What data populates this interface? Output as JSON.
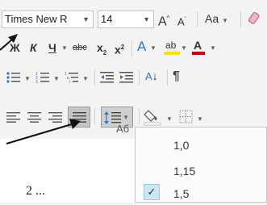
{
  "font": {
    "family_value": "Times New R",
    "size_value": "14",
    "grow_label": "A",
    "shrink_label": "A",
    "case_label": "Aa",
    "bold": "Ж",
    "italic": "К",
    "underline": "Ч",
    "strike": "abc",
    "subscript": "x",
    "superscript": "x",
    "effects": "A",
    "highlight": "ab",
    "color": "A"
  },
  "paragraph": {
    "sort_label": "A",
    "show_marks": "¶",
    "group_label": "Аб"
  },
  "line_spacing_menu": {
    "items": [
      {
        "label": "1,0",
        "checked": false
      },
      {
        "label": "1,15",
        "checked": false
      },
      {
        "label": "1,5",
        "checked": true
      }
    ]
  },
  "document": {
    "visible_text": "2 ..."
  },
  "colors": {
    "highlight_yellow": "#f5e400",
    "font_red": "#d00000",
    "effects_blue": "#2e75c8",
    "selected_bg": "#cde6f7"
  }
}
